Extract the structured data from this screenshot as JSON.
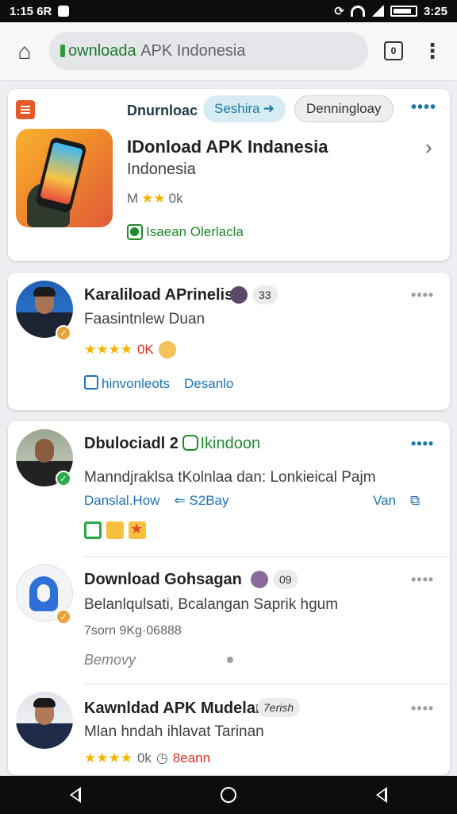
{
  "status": {
    "time_left": "1:15 6R",
    "time_right": "3:25"
  },
  "browser": {
    "url_main": "ownloada",
    "url_rest": "APK Indonesia",
    "tab_count": "0",
    "menu_glyph": "⋮"
  },
  "card1": {
    "label": "Dnurnloac",
    "chip_primary": "Seshira",
    "chip_secondary": "Denningloay",
    "more": "••••",
    "title": "IDonload APK Indanesia",
    "subtitle": "Indonesia",
    "rating_prefix": "M",
    "rating_value": "0k",
    "verified": "Isaean Olerlacla"
  },
  "card2": {
    "name": "Karaliload APrinelis",
    "pill": "33",
    "line": "Faasintnlew Duan",
    "rating_value": "0K",
    "link1": "hinvonleots",
    "link2": "Desanlo"
  },
  "card3": {
    "post1": {
      "name": "Dbulociadl 2",
      "tag": "Ikindoon",
      "line": "Manndjraklsa tKolnlaa dan: Lonkieical Pajm",
      "link1": "Danslal.How",
      "link2": "S2Bay",
      "link3": "Van"
    },
    "post2": {
      "name": "Download Gohsagan",
      "pill": "09",
      "line": "Belanlqulsati, Bcalangan Saprik hgum",
      "meta": "7sorn 9Kg·06888",
      "meta2": "Bemovy"
    },
    "post3": {
      "name": "Kawnldad APK Mudelan",
      "pill": "7erish",
      "line": "Mlan hndah ihlavat Tarinan",
      "rating_value": "0k",
      "extra": "8eann"
    }
  }
}
